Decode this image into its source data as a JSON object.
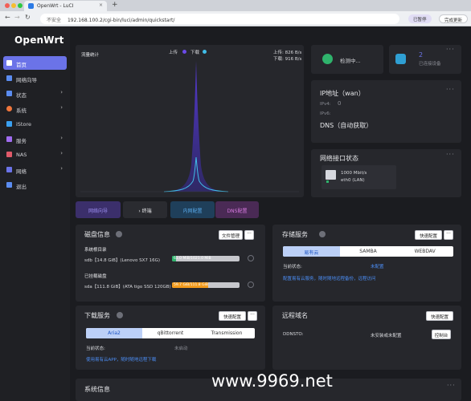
{
  "browser": {
    "tab_title": "OpenWrt - LuCI",
    "tab_close": "×",
    "new_tab": "+",
    "insecure_label": "不安全",
    "url": "192.168.100.2/cgi-bin/luci/admin/quickstart/",
    "paused_label": "已暂停",
    "update_label": "完成更新"
  },
  "sidebar": {
    "brand": "OpenWrt",
    "items": [
      {
        "label": "首页",
        "arrow": ""
      },
      {
        "label": "网络向导",
        "arrow": ""
      },
      {
        "label": "状态",
        "arrow": "›"
      },
      {
        "label": "系统",
        "arrow": "›"
      },
      {
        "label": "iStore",
        "arrow": ""
      },
      {
        "label": "服务",
        "arrow": "›"
      },
      {
        "label": "NAS",
        "arrow": "›"
      },
      {
        "label": "网络",
        "arrow": "›"
      },
      {
        "label": "退出",
        "arrow": ""
      }
    ]
  },
  "traffic": {
    "title": "流量统计",
    "upload_legend": "上传",
    "download_legend": "下载",
    "upload_rate": "上传: 826 B/s",
    "download_rate": "下载: 916 B/s"
  },
  "status": {
    "detecting": "检测中...",
    "devices_count": "2",
    "devices_label": "已连接设备"
  },
  "ip": {
    "title": "IP地址（wan）",
    "ipv4_label": "IPv4:",
    "ipv4_value": "0",
    "ipv6_label": "IPv6:",
    "dns_label": "DNS（自动获取）"
  },
  "interfaces": {
    "title": "网络接口状态",
    "speed": "1000 Mbit/s",
    "name": "eth0 (LAN)"
  },
  "quick": {
    "wizard": "网络向导",
    "terminal": "终端",
    "lan": "内网配置",
    "dns": "DNS配置"
  },
  "disk": {
    "title": "磁盘信息",
    "file_manager": "文件管理",
    "sys_dir": "系统根目录",
    "sys_disk": "sdb【14.8 GiB】(Lenovo SX7 16G)",
    "sys_usage": "61.0 MiB/1021.0 MiB",
    "sys_fraction": 0.06,
    "mounted": "已挂载磁盘",
    "data_disk": "sda【111.8 GiB】(ATA tigo SSD 120GB)",
    "data_usage": "59.7 GiB/111.8 GiB",
    "data_fraction": 0.53
  },
  "storage": {
    "title": "存储服务",
    "quick_config": "快速配置",
    "tabs": [
      "易有云",
      "SAMBA",
      "WEBDAV"
    ],
    "status_label": "当前状态:",
    "status_value": "未配置",
    "link": "配置易有云服务，随时随地远程备份，远程访问"
  },
  "download": {
    "title": "下载服务",
    "quick_config": "快速配置",
    "tabs": [
      "Aria2",
      "qBittorrent",
      "Transmission"
    ],
    "status_label": "当前状态:",
    "status_value": "未启动",
    "link": "使用易有云APP，随时随地远程下载"
  },
  "domain": {
    "title": "远程域名",
    "quick_config": "快速配置",
    "ddns_label": "DDNSTO:",
    "ddns_value": "未安装或未配置",
    "control": "控制台"
  },
  "sysinfo": {
    "title": "系统信息"
  },
  "watermark": "www.9969.net"
}
